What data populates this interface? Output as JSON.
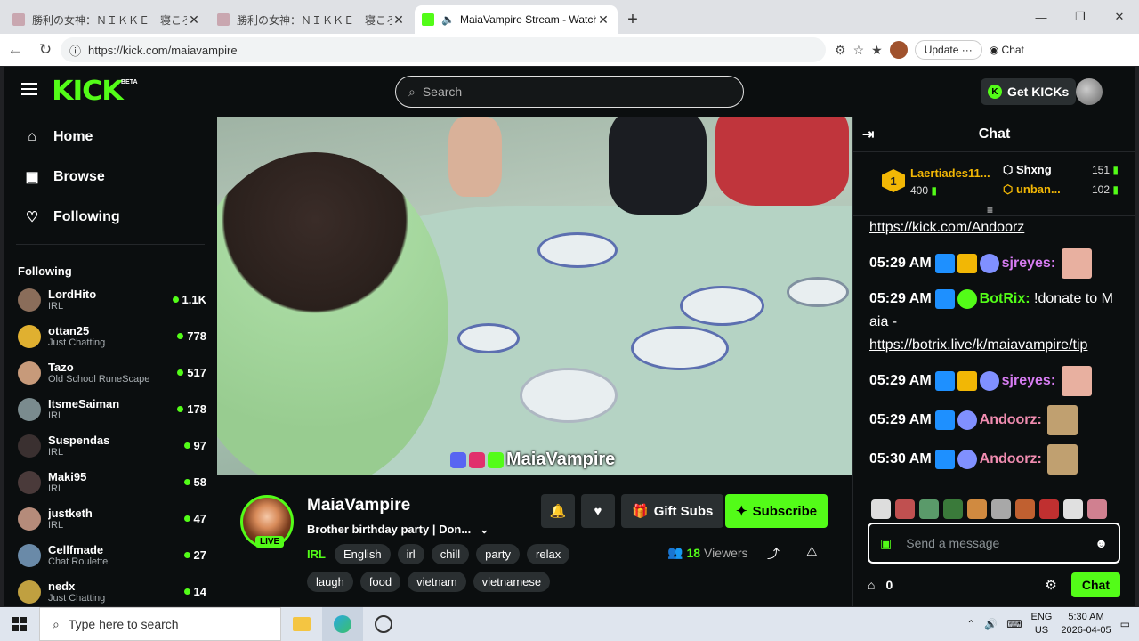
{
  "browser": {
    "tabs": [
      {
        "title": "勝利の女神：ＮＩＫＫＥ　寝ころび",
        "active": false
      },
      {
        "title": "勝利の女神：ＮＩＫＫＥ　寝ころび",
        "active": false
      },
      {
        "title": "MaiaVampire Stream - Watch",
        "active": true
      }
    ],
    "url": "https://kick.com/maiavampire",
    "update_label": "Update",
    "chat_label": "Chat"
  },
  "header": {
    "logo": "KICK",
    "beta": "BETA",
    "search_placeholder": "Search",
    "get_kicks": "Get KICKs"
  },
  "sidebar": {
    "nav": [
      {
        "label": "Home",
        "icon": "home-icon"
      },
      {
        "label": "Browse",
        "icon": "browse-icon"
      },
      {
        "label": "Following",
        "icon": "heart-icon"
      }
    ],
    "following_title": "Following",
    "following": [
      {
        "name": "LordHito",
        "category": "IRL",
        "viewers": "1.1K",
        "color": "#8a6d5a"
      },
      {
        "name": "ottan25",
        "category": "Just Chatting",
        "viewers": "778",
        "color": "#e0b030"
      },
      {
        "name": "Tazo",
        "category": "Old School RuneScape",
        "viewers": "517",
        "color": "#c79a7a"
      },
      {
        "name": "ItsmeSaiman",
        "category": "IRL",
        "viewers": "178",
        "color": "#7a8b8e"
      },
      {
        "name": "Suspendas",
        "category": "IRL",
        "viewers": "97",
        "color": "#3a3030"
      },
      {
        "name": "Maki95",
        "category": "IRL",
        "viewers": "58",
        "color": "#4a3a3a"
      },
      {
        "name": "justketh",
        "category": "IRL",
        "viewers": "47",
        "color": "#b58b7a"
      },
      {
        "name": "Cellfmade",
        "category": "Chat Roulette",
        "viewers": "27",
        "color": "#6a8aa8"
      },
      {
        "name": "nedx",
        "category": "Just Chatting",
        "viewers": "14",
        "color": "#c0a040"
      }
    ]
  },
  "video": {
    "overlay_name": "MaiaVampire"
  },
  "channel": {
    "name": "MaiaVampire",
    "live": "LIVE",
    "title": "Brother birthday party | Don...",
    "category": "IRL",
    "tags": [
      "English",
      "irl",
      "chill",
      "party",
      "relax",
      "laugh",
      "food",
      "vietnam",
      "vietnamese"
    ],
    "gift_label": "Gift Subs",
    "subscribe_label": "Subscribe",
    "viewers": "18",
    "viewers_label": "Viewers"
  },
  "chat": {
    "title": "Chat",
    "leaderboard": {
      "first": {
        "rank": "1",
        "name": "Laertiades11...",
        "value": "400"
      },
      "others": [
        {
          "name": "Shxng",
          "value": "151"
        },
        {
          "name": "unban...",
          "value": "102"
        }
      ]
    },
    "messages": [
      {
        "time": "",
        "user": "",
        "text": "https://kick.com/Andoorz",
        "link": true
      },
      {
        "time": "05:29 AM",
        "user": "sjreyes:",
        "text": "",
        "color": "#d77cf2"
      },
      {
        "time": "05:29 AM",
        "user": "BotRix:",
        "text": "!donate to Maia - ",
        "link_text": "https://botrix.live/k/maiavampire/tip",
        "color": "#53fc18"
      },
      {
        "time": "05:29 AM",
        "user": "sjreyes:",
        "text": "",
        "color": "#d77cf2"
      },
      {
        "time": "05:29 AM",
        "user": "Andoorz:",
        "text": "",
        "color": "#f08cb0"
      },
      {
        "time": "05:30 AM",
        "user": "Andoorz:",
        "text": "",
        "color": "#f08cb0"
      }
    ],
    "input_placeholder": "Send a message",
    "points": "0",
    "send_label": "Chat"
  },
  "taskbar": {
    "search_placeholder": "Type here to search",
    "lang": "ENG",
    "region": "US",
    "time": "5:30 AM",
    "date": "2026-04-05"
  }
}
